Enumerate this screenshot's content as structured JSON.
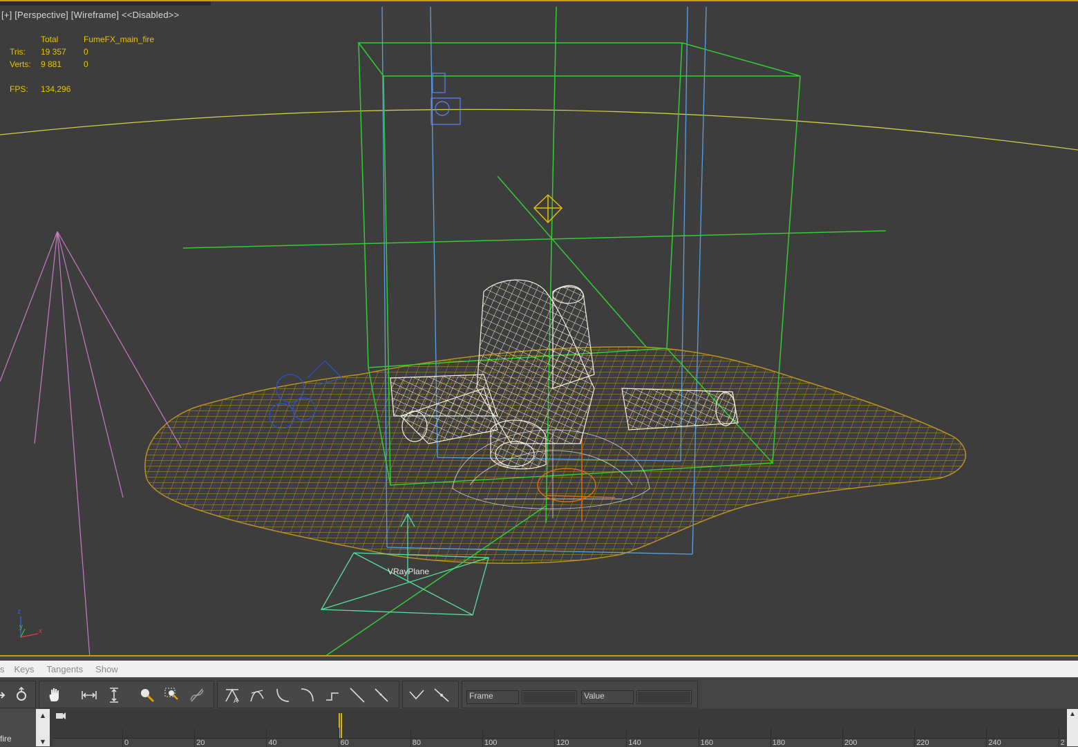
{
  "viewport": {
    "labels": [
      "[+]",
      "[Perspective]",
      "[Wireframe]",
      "<<Disabled>>"
    ],
    "stats": {
      "header_total": "Total",
      "header_object": "FumeFX_main_fire",
      "tris_label": "Tris:",
      "tris_total": "19 357",
      "tris_object": "0",
      "verts_label": "Verts:",
      "verts_total": "9 881",
      "verts_object": "0",
      "fps_label": "FPS:",
      "fps_value": "134,296"
    },
    "object_label": "VRayPlane",
    "axis": {
      "z": "z",
      "y": "y",
      "x": "x"
    }
  },
  "menu": {
    "items": [
      "s",
      "Keys",
      "Tangents",
      "Show"
    ]
  },
  "toolbar": {
    "frame_label": "Frame",
    "value_label": "Value",
    "frame_value": "",
    "value_value": ""
  },
  "track": {
    "controller_label": "fire",
    "ruler_ticks": [
      "0",
      "20",
      "40",
      "60",
      "80",
      "100",
      "120",
      "140",
      "160",
      "180",
      "200",
      "220",
      "240",
      "2"
    ],
    "current_frame": 60
  },
  "colors": {
    "viewport_bg": "#3d3d3d",
    "active_border": "#c8a000",
    "stats_text": "#e6c400",
    "green_wire": "#33cc33",
    "blue_wire": "#5aa0e0",
    "ground_mesh": "#c89a1e",
    "log_wire": "#ffffff",
    "light_wire": "#cc77cc"
  },
  "icons": [
    "move-icon",
    "pan-icon",
    "zoom-horizontal-extents-icon",
    "zoom-value-extents-icon",
    "zoom-icon",
    "zoom-region-icon",
    "isolate-curve-icon",
    "set-tangents-auto-icon",
    "set-tangents-spline-icon",
    "set-tangents-fast-icon",
    "set-tangents-slow-icon",
    "set-tangents-step-icon",
    "set-tangents-linear-icon",
    "set-tangents-smooth-icon",
    "break-tangents-icon",
    "unify-tangents-icon"
  ]
}
